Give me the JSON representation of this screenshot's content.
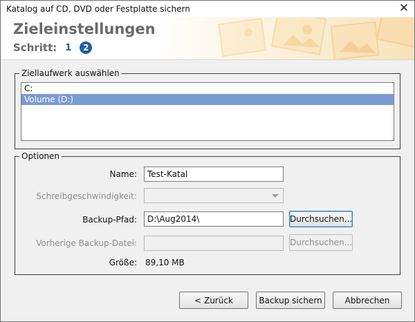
{
  "window": {
    "title": "Katalog auf CD, DVD oder Festplatte sichern",
    "close_glyph": "✕"
  },
  "header": {
    "heading": "Zieleinstellungen",
    "steps_label": "Schritt:",
    "step1": "1",
    "step2": "2"
  },
  "drive_group": {
    "legend": "Ziellaufwerk auswählen",
    "items": [
      {
        "label": "C:",
        "selected": false
      },
      {
        "label": "Volume (D:)",
        "selected": true
      }
    ]
  },
  "options_group": {
    "legend": "Optionen",
    "name_label": "Name:",
    "name_value": "Test-Katal",
    "speed_label": "Schreibgeschwindigkeit:",
    "speed_value": "",
    "path_label": "Backup-Pfad:",
    "path_value": "D:\\Aug2014\\",
    "browse_label": "Durchsuchen...",
    "prev_label": "Vorherige Backup-Datei:",
    "prev_value": "",
    "browse2_label": "Durchsuchen...",
    "size_label": "Größe:",
    "size_value": "89,10 MB"
  },
  "footer": {
    "back_label": "< Zurück",
    "save_label": "Backup sichern",
    "cancel_label": "Abbrechen"
  },
  "colors": {
    "accent": "#1f5fa6",
    "selection": "#7b9bd3"
  }
}
